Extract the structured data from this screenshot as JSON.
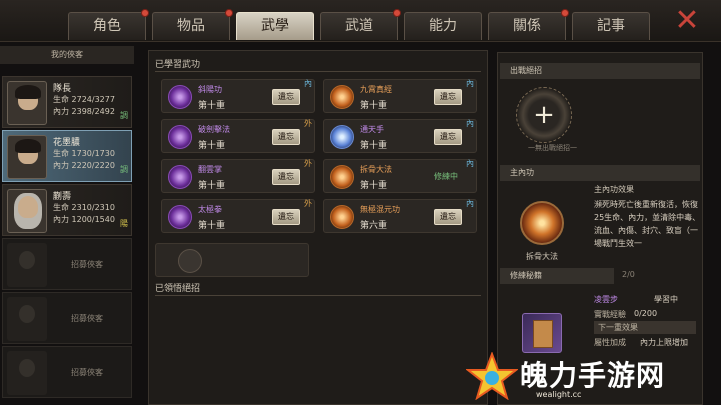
{
  "tabs": [
    {
      "label": "角色",
      "dot": true
    },
    {
      "label": "物品",
      "dot": true
    },
    {
      "label": "武學",
      "dot": false,
      "active": true
    },
    {
      "label": "武道",
      "dot": true
    },
    {
      "label": "能力",
      "dot": false
    },
    {
      "label": "關係",
      "dot": true
    },
    {
      "label": "記事",
      "dot": false
    }
  ],
  "close_icon": "close-x-icon",
  "sidebar": {
    "title": "我的俠客",
    "characters": [
      {
        "name": "隊長",
        "hp": "生命 2724/3277",
        "mp": "內力 2398/2492",
        "tag": "調",
        "selected": false
      },
      {
        "name": "花墨膿",
        "hp": "生命 1730/1730",
        "mp": "內力 2220/2220",
        "tag": "調",
        "selected": true
      },
      {
        "name": "蒯壽",
        "hp": "生命 2310/2310",
        "mp": "內力 1200/1540",
        "tag": "陽",
        "selected": false
      }
    ],
    "empty_slots": [
      "招募俠客",
      "招募俠客",
      "招募俠客"
    ]
  },
  "learned": {
    "title": "已學習武功",
    "skills": [
      {
        "name": "斜陽功",
        "level": "第十重",
        "action": "遺忘",
        "badge": "內",
        "icon": "purple-orb-icon",
        "color": "purple"
      },
      {
        "name": "九霄真經",
        "level": "第十重",
        "action": "遺忘",
        "badge": "內",
        "icon": "orange-swirl-icon",
        "color": "orange"
      },
      {
        "name": "破劍擊法",
        "level": "第十重",
        "action": "遺忘",
        "badge": "外",
        "icon": "purple-blade-icon",
        "color": "purple"
      },
      {
        "name": "通天手",
        "level": "第十重",
        "action": "遺忘",
        "badge": "內",
        "icon": "blue-hand-icon",
        "color": "blue"
      },
      {
        "name": "翻雲掌",
        "level": "第十重",
        "action": "遺忘",
        "badge": "外",
        "icon": "purple-palm-icon",
        "color": "purple"
      },
      {
        "name": "拆骨大法",
        "level": "第十重",
        "action": "修練中",
        "badge": "內",
        "icon": "orange-seal-icon",
        "color": "orange"
      },
      {
        "name": "太極拳",
        "level": "第十重",
        "action": "遺忘",
        "badge": "外",
        "icon": "purple-fist-icon",
        "color": "purple"
      },
      {
        "name": "無極混元功",
        "level": "第六重",
        "action": "遺忘",
        "badge": "內",
        "icon": "orange-flame-icon",
        "color": "orange"
      }
    ],
    "forgotten_title": "已領悟絕招"
  },
  "right": {
    "ultimate_title": "出戰絕招",
    "plus_hint": "一無出戰絕招一",
    "inner_title": "主內功",
    "inner_name": "拆骨大法",
    "effect_title": "主內功效果",
    "effect_text": "瀕死時死亡後重新復活，恢復25生命、內力，並清除中毒、流血、內傷、封穴、致盲（一場戰鬥生效一",
    "train_value": "2/0",
    "training_title": "修練秘籍",
    "training_skill": "凌雲步",
    "training_status": "學習中",
    "exp_label": "實戰經驗",
    "exp_value": "0/200",
    "next_label": "下一重效果",
    "attr_label": "屬性加成",
    "attr_value": "內力上限增加"
  },
  "watermark": {
    "text": "魄力手游网",
    "url": "wealight.cc"
  }
}
